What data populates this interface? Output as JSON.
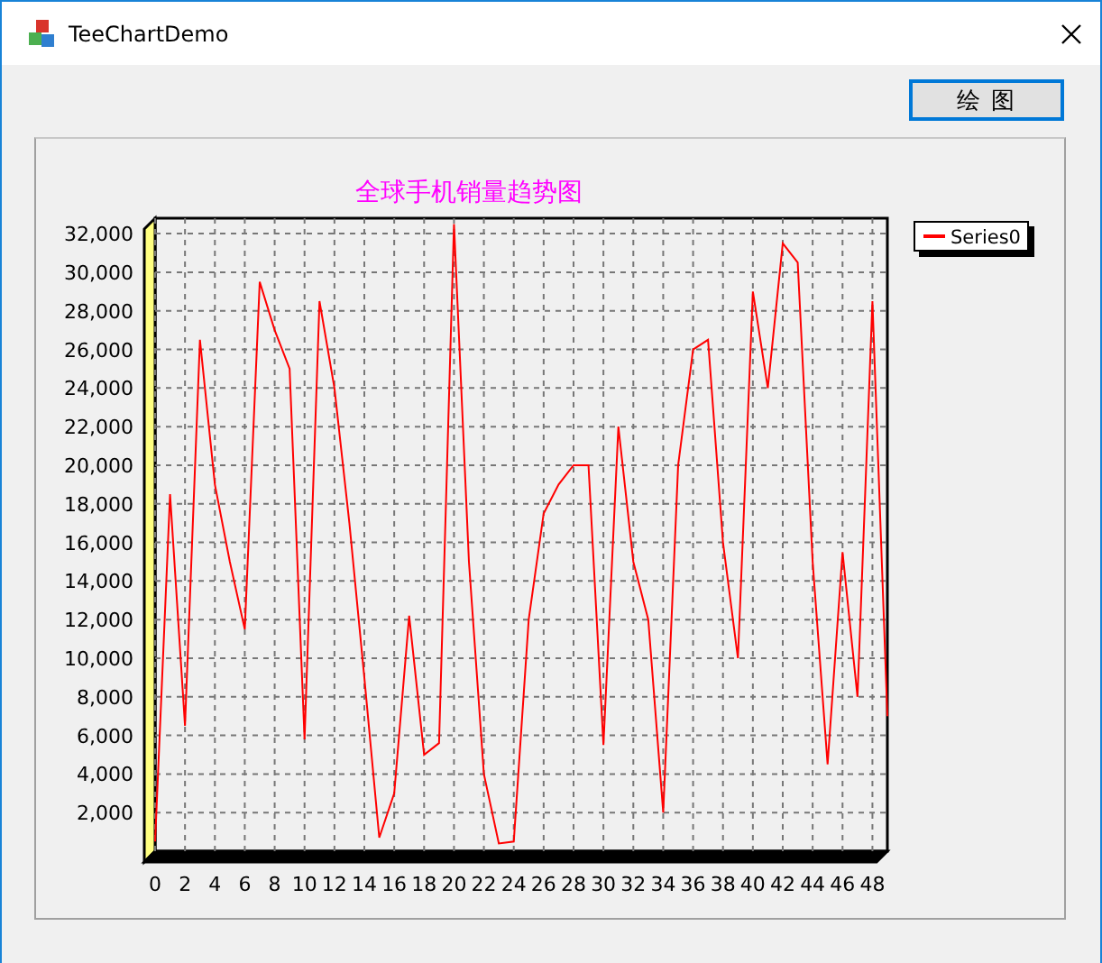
{
  "window": {
    "title": "TeeChartDemo"
  },
  "toolbar": {
    "button": "绘 图"
  },
  "chart": {
    "chart_data": {
      "type": "line",
      "grid": true,
      "xlim": [
        0,
        49
      ],
      "title": "全球手机销量趋势图",
      "x": [
        0,
        1,
        2,
        3,
        4,
        5,
        6,
        7,
        8,
        9,
        10,
        11,
        12,
        13,
        14,
        15,
        16,
        17,
        18,
        19,
        20,
        21,
        22,
        23,
        24,
        25,
        26,
        27,
        28,
        29,
        30,
        31,
        32,
        33,
        34,
        35,
        36,
        37,
        38,
        39,
        40,
        41,
        42,
        43,
        44,
        45,
        46,
        47,
        48,
        49
      ],
      "series": [
        {
          "name": "Series0",
          "color": "#ff0000",
          "values": [
            500,
            18500,
            6500,
            26500,
            19000,
            15000,
            11500,
            29500,
            27000,
            25000,
            5800,
            28500,
            24000,
            17000,
            9000,
            700,
            3000,
            12200,
            5000,
            5600,
            32500,
            15000,
            4000,
            400,
            500,
            12000,
            17500,
            19000,
            20000,
            20000,
            5500,
            22000,
            15000,
            12000,
            2000,
            20000,
            26000,
            26500,
            16000,
            10000,
            29000,
            24000,
            31500,
            30500,
            15000,
            4500,
            15500,
            8000,
            28500,
            7000
          ]
        }
      ],
      "ylim": [
        0,
        32800
      ],
      "xticks": [
        0,
        2,
        4,
        6,
        8,
        10,
        12,
        14,
        16,
        18,
        20,
        22,
        24,
        26,
        28,
        30,
        32,
        34,
        36,
        38,
        40,
        42,
        44,
        46,
        48
      ],
      "yticks": [
        {
          "value": 2000,
          "label": "2,000"
        },
        {
          "value": 4000,
          "label": "4,000"
        },
        {
          "value": 6000,
          "label": "6,000"
        },
        {
          "value": 8000,
          "label": "8,000"
        },
        {
          "value": 10000,
          "label": "10,000"
        },
        {
          "value": 12000,
          "label": "12,000"
        },
        {
          "value": 14000,
          "label": "14,000"
        },
        {
          "value": 16000,
          "label": "16,000"
        },
        {
          "value": 18000,
          "label": "18,000"
        },
        {
          "value": 20000,
          "label": "20,000"
        },
        {
          "value": 22000,
          "label": "22,000"
        },
        {
          "value": 24000,
          "label": "24,000"
        },
        {
          "value": 26000,
          "label": "26,000"
        },
        {
          "value": 28000,
          "label": "28,000"
        },
        {
          "value": 30000,
          "label": "30,000"
        },
        {
          "value": 32000,
          "label": "32,000"
        }
      ]
    }
  }
}
